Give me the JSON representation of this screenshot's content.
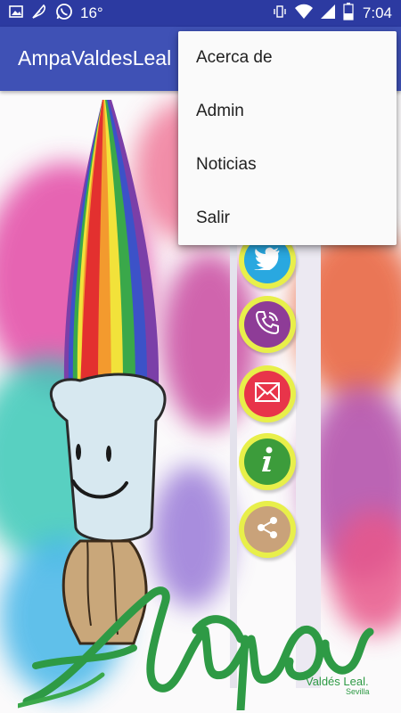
{
  "status_bar": {
    "temperature": "16°",
    "time": "7:04",
    "left_icons": [
      "image-icon",
      "feather-icon",
      "whatsapp-icon"
    ],
    "right_icons": [
      "vibrate-icon",
      "wifi-icon",
      "signal-icon",
      "battery-icon"
    ]
  },
  "app_bar": {
    "title": "AmpaValdesLeal",
    "color": "#3f51b5",
    "status_color": "#2c3aa1"
  },
  "menu": {
    "items": [
      {
        "label": "Acerca de"
      },
      {
        "label": "Admin"
      },
      {
        "label": "Noticias"
      },
      {
        "label": "Salir"
      }
    ]
  },
  "social_buttons": [
    {
      "icon": "twitter-icon",
      "color": "#29a8e0"
    },
    {
      "icon": "phone-icon",
      "color": "#8e3c97"
    },
    {
      "icon": "mail-icon",
      "color": "#e8344a"
    },
    {
      "icon": "info-icon",
      "color": "#3c9c3b"
    },
    {
      "icon": "share-icon",
      "color": "#c9a27a"
    }
  ],
  "brand": {
    "logo_text": "Ampa",
    "subtitle": "Valdés Leal.",
    "city": "Sevilla",
    "color": "#2e9a45"
  }
}
